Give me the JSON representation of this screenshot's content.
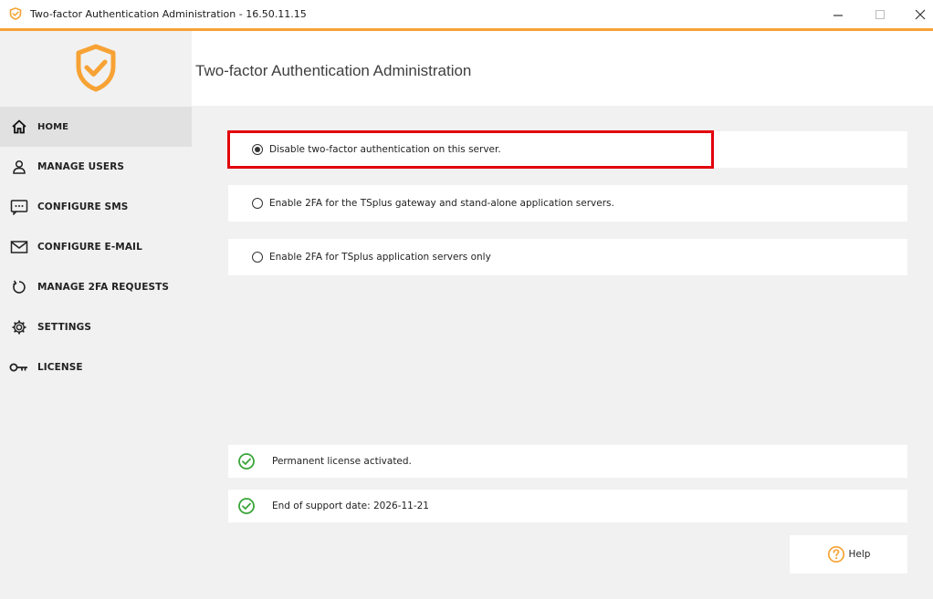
{
  "window": {
    "title": "Two-factor Authentication Administration - 16.50.11.15",
    "accent_color": "#f7a234"
  },
  "header": {
    "title": "Two-factor Authentication Administration"
  },
  "sidebar": {
    "items": [
      {
        "label": "HOME",
        "icon": "home-icon",
        "active": true
      },
      {
        "label": "MANAGE USERS",
        "icon": "user-icon"
      },
      {
        "label": "CONFIGURE SMS",
        "icon": "sms-icon"
      },
      {
        "label": "CONFIGURE E-MAIL",
        "icon": "envelope-icon"
      },
      {
        "label": "MANAGE 2FA REQUESTS",
        "icon": "reset-icon"
      },
      {
        "label": "SETTINGS",
        "icon": "gear-icon"
      },
      {
        "label": "LICENSE",
        "icon": "key-icon"
      }
    ]
  },
  "main": {
    "options": [
      {
        "label": "Disable two-factor authentication on this server.",
        "selected": true
      },
      {
        "label": "Enable 2FA for the TSplus gateway and stand-alone application servers.",
        "selected": false
      },
      {
        "label": "Enable 2FA for TSplus application servers only",
        "selected": false
      }
    ],
    "status": [
      {
        "label": "Permanent license activated.",
        "icon": "check-circle-icon"
      },
      {
        "label": "End of support date: 2026-11-21",
        "icon": "check-circle-icon"
      }
    ],
    "help_label": "Help",
    "status_color": "#3aa53a",
    "highlight_color": "#e3000b"
  }
}
